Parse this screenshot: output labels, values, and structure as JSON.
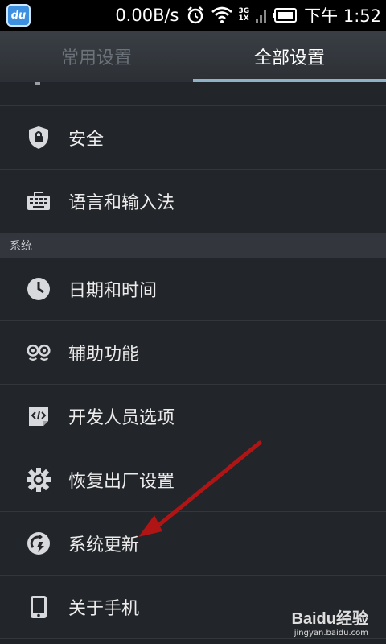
{
  "status_bar": {
    "app_icon_label": "du",
    "speed": "0.00B/s",
    "network_top": "3G",
    "network_bottom": "1X",
    "time": "下午 1:52"
  },
  "tabs": [
    {
      "label": "常用设置",
      "active": false
    },
    {
      "label": "全部设置",
      "active": true
    }
  ],
  "items": {
    "security": "安全",
    "language": "语言和输入法",
    "section_system": "系统",
    "datetime": "日期和时间",
    "accessibility": "辅助功能",
    "developer": "开发人员选项",
    "reset": "恢复出厂设置",
    "update": "系统更新",
    "about": "关于手机"
  },
  "watermark": {
    "brand": "Baidu经验",
    "site": "jingyan.baidu.com"
  },
  "colors": {
    "tab_indicator": "#8fb2c8",
    "annotation_arrow": "#b01515"
  },
  "icons": [
    "shield-lock-icon",
    "keyboard-icon",
    "clock-icon",
    "accessibility-icon",
    "developer-code-icon",
    "gear-reset-icon",
    "system-update-icon",
    "phone-icon",
    "alarm-icon",
    "wifi-icon",
    "battery-icon"
  ]
}
